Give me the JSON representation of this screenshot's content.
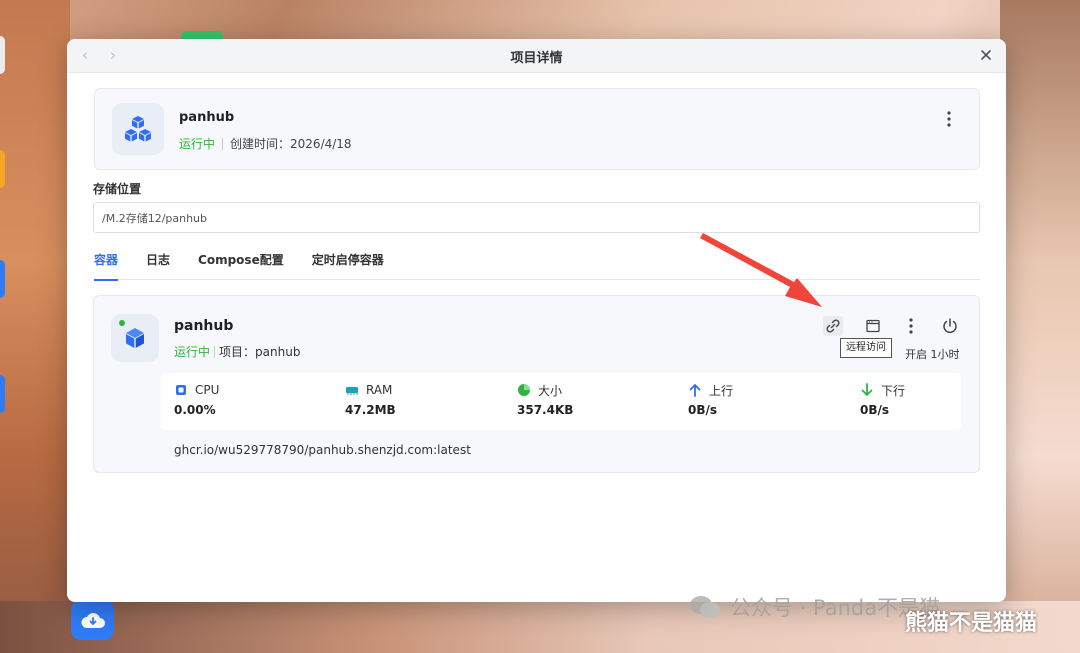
{
  "window": {
    "title": "项目详情",
    "close_icon": "close-icon",
    "back_icon": "chevron-left-icon",
    "forward_icon": "chevron-right-icon"
  },
  "project": {
    "name": "panhub",
    "status": "运行中",
    "created_label": "创建时间：",
    "created_value": "2026/4/18",
    "icon": "cubes-icon",
    "more_icon": "more-vertical-icon"
  },
  "storage": {
    "label": "存储位置",
    "value": "/M.2存储12/panhub"
  },
  "tabs": [
    {
      "label": "容器",
      "active": true
    },
    {
      "label": "日志",
      "active": false
    },
    {
      "label": "Compose配置",
      "active": false
    },
    {
      "label": "定时启停容器",
      "active": false
    }
  ],
  "container": {
    "name": "panhub",
    "status": "运行中",
    "project_label": "项目：",
    "project_value": "panhub",
    "tooltip": "远程访问",
    "uptime": "开启 1小时",
    "image": "ghcr.io/wu529778790/panhub.shenzjd.com:latest",
    "status_color": "#36b03d",
    "stats": [
      {
        "label": "CPU",
        "value": "0.00%",
        "icon": "cpu-icon",
        "color": "#2f6df6"
      },
      {
        "label": "RAM",
        "value": "47.2MB",
        "icon": "ram-icon",
        "color": "#1aa3b8"
      },
      {
        "label": "大小",
        "value": "357.4KB",
        "icon": "pie-chart-icon",
        "color": "#2fb343"
      },
      {
        "label": "上行",
        "value": "0B/s",
        "icon": "arrow-up-icon",
        "color": "#2f6df6"
      },
      {
        "label": "下行",
        "value": "0B/s",
        "icon": "arrow-down-icon",
        "color": "#2fb343"
      }
    ]
  },
  "watermark": {
    "wechat": "公众号 · Panda不是猫",
    "red": "熊猫不是猫猫"
  },
  "colors": {
    "accent": "#2f6df6",
    "running": "#36b03d",
    "arrow": "#f0453a"
  }
}
